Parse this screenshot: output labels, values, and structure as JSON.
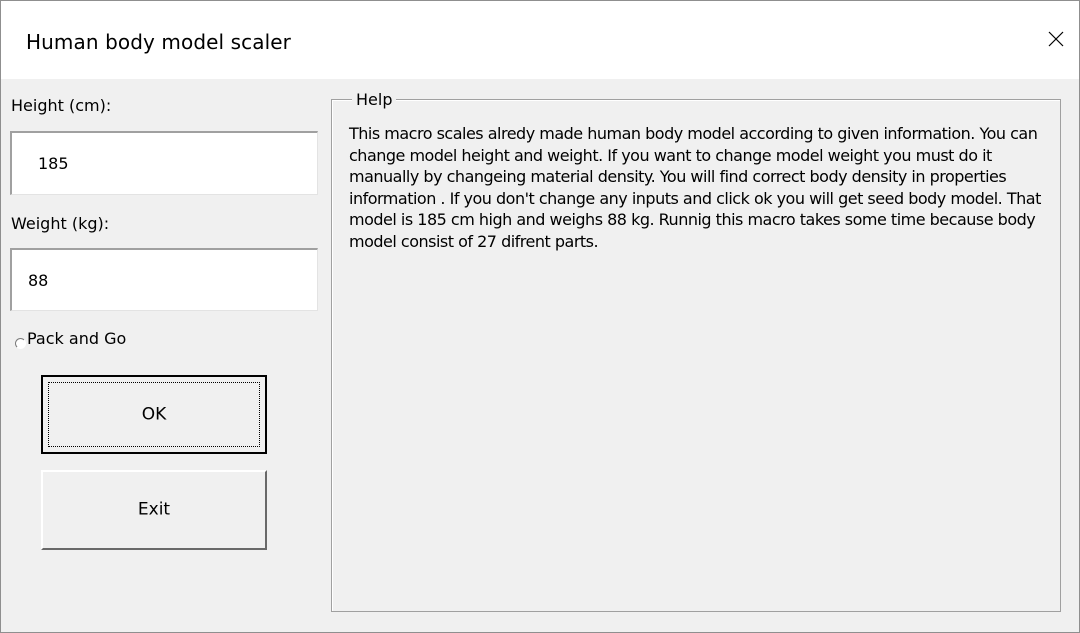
{
  "window": {
    "title": "Human body model scaler",
    "close_symbol": "×"
  },
  "form": {
    "height_label": "Height (cm):",
    "height_value": "185",
    "weight_label": "Weight (kg):",
    "weight_value": "88",
    "pack_and_go_label": "Pack and Go",
    "pack_and_go_checked": false,
    "ok_label": "OK",
    "exit_label": "Exit"
  },
  "help": {
    "caption": "Help",
    "text": "This macro scales alredy made human body model according to given information. You can change model height and weight. If you want to change model weight you must do it manually by changeing material density. You will find correct body density in properties information . If you don't change any inputs  and click ok you will get seed body model. That model is 185 cm high and weighs 88 kg. Runnig this macro takes some time because body model consist of 27 difrent parts."
  },
  "icons": {
    "close": "close-icon",
    "radio": "radio-button-icon"
  },
  "colors": {
    "dialog_background": "#f0f0f0",
    "titlebar_background": "#ffffff",
    "input_background": "#ffffff",
    "frame_border": "#a0a0a0",
    "text": "#000000"
  }
}
